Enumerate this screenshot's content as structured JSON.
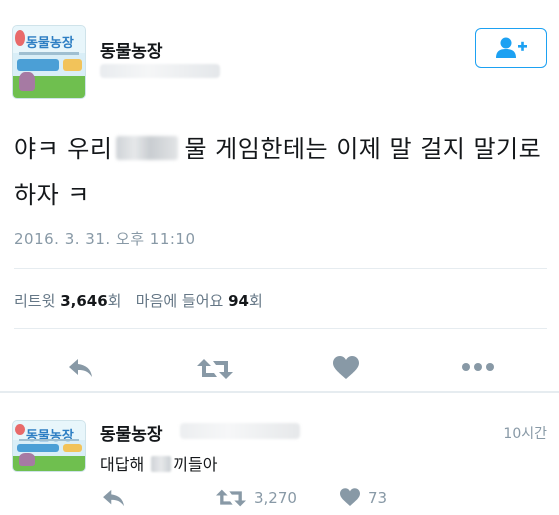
{
  "tweet": {
    "display_name": "동물농장",
    "avatar_title": "동물농장",
    "text_part1": "야ㅋ 우리",
    "text_part2": "물 게임한테는 이제 말 걸지 말기로 하자 ㅋ",
    "timestamp": "2016. 3. 31. 오후 11:10",
    "retweets_label": "리트윗",
    "retweets_count": "3,646",
    "count_suffix": "회",
    "likes_label": "마음에 들어요",
    "likes_count": "94"
  },
  "reply": {
    "display_name": "동물농장",
    "avatar_title": "동물농장",
    "time": "10시간",
    "text_part1": "대답해",
    "text_part2": "끼들아",
    "retweet_count": "3,270",
    "like_count": "73"
  },
  "icons": {
    "follow": "follow-user-plus-icon",
    "reply": "reply-arrow-icon",
    "retweet": "retweet-icon",
    "like": "heart-icon",
    "more": "more-dots-icon"
  },
  "colors": {
    "accent": "#1da1f2",
    "icon_gray": "#8899a6",
    "text": "#14171a"
  }
}
